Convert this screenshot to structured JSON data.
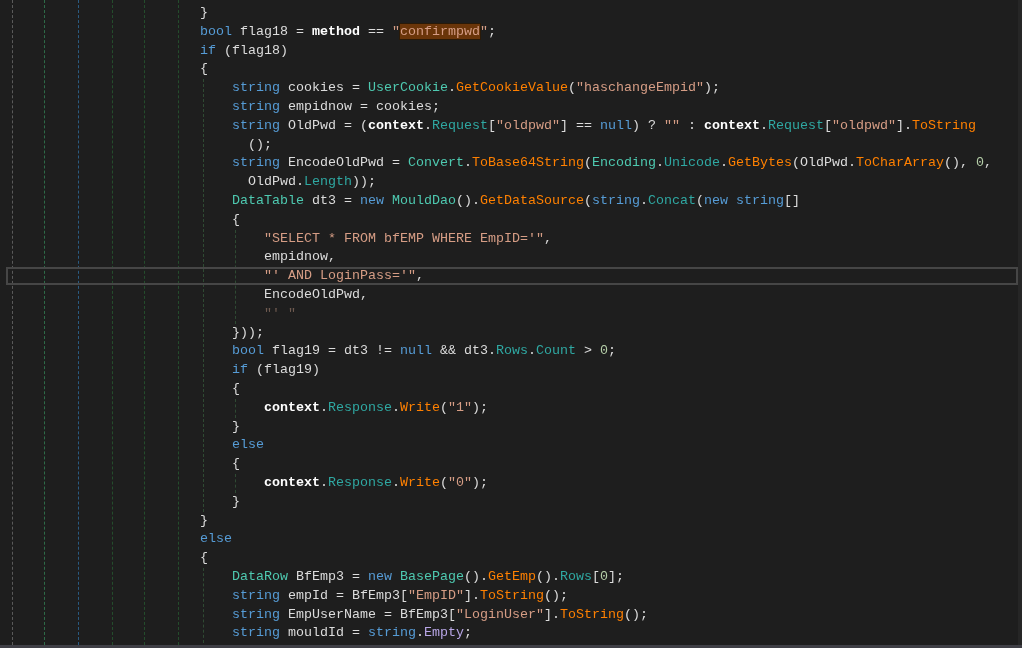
{
  "editor": {
    "lines": [
      {
        "kind": "line",
        "tokens": [
          {
            "text": "}",
            "kind": "plain"
          }
        ]
      },
      {
        "kind": "line",
        "tokens": [
          {
            "text": "bool",
            "kind": "kw"
          },
          {
            "text": " flag18 = ",
            "kind": "plain"
          },
          {
            "text": "method",
            "kind": "bold"
          },
          {
            "text": " == ",
            "kind": "plain"
          },
          {
            "text": "\"",
            "kind": "str"
          },
          {
            "text": "confirmpwd",
            "kind": "match"
          },
          {
            "text": "\"",
            "kind": "str"
          },
          {
            "text": ";",
            "kind": "plain"
          }
        ]
      },
      {
        "kind": "line",
        "tokens": [
          {
            "text": "if",
            "kind": "kw"
          },
          {
            "text": " (flag18)",
            "kind": "plain"
          }
        ]
      },
      {
        "kind": "line",
        "tokens": [
          {
            "text": "{",
            "kind": "plain"
          }
        ]
      },
      {
        "kind": "block",
        "children": [
          {
            "kind": "line",
            "tokens": [
              {
                "text": "string",
                "kind": "kw"
              },
              {
                "text": " cookies = ",
                "kind": "plain"
              },
              {
                "text": "UserCookie",
                "kind": "type"
              },
              {
                "text": ".",
                "kind": "plain"
              },
              {
                "text": "GetCookieValue",
                "kind": "method"
              },
              {
                "text": "(",
                "kind": "plain"
              },
              {
                "text": "\"haschangeEmpid\"",
                "kind": "str"
              },
              {
                "text": ");",
                "kind": "plain"
              }
            ]
          },
          {
            "kind": "line",
            "tokens": [
              {
                "text": "string",
                "kind": "kw"
              },
              {
                "text": " empidnow = cookies;",
                "kind": "plain"
              }
            ]
          },
          {
            "kind": "line",
            "tokens": [
              {
                "text": "string",
                "kind": "kw"
              },
              {
                "text": " OldPwd = (",
                "kind": "plain"
              },
              {
                "text": "context",
                "kind": "bold"
              },
              {
                "text": ".",
                "kind": "plain"
              },
              {
                "text": "Request",
                "kind": "member"
              },
              {
                "text": "[",
                "kind": "plain"
              },
              {
                "text": "\"oldpwd\"",
                "kind": "str"
              },
              {
                "text": "] == ",
                "kind": "plain"
              },
              {
                "text": "null",
                "kind": "kw"
              },
              {
                "text": ") ? ",
                "kind": "plain"
              },
              {
                "text": "\"\"",
                "kind": "str"
              },
              {
                "text": " : ",
                "kind": "plain"
              },
              {
                "text": "context",
                "kind": "bold"
              },
              {
                "text": ".",
                "kind": "plain"
              },
              {
                "text": "Request",
                "kind": "member"
              },
              {
                "text": "[",
                "kind": "plain"
              },
              {
                "text": "\"oldpwd\"",
                "kind": "str"
              },
              {
                "text": "].",
                "kind": "plain"
              },
              {
                "text": "ToString",
                "kind": "method"
              }
            ]
          },
          {
            "kind": "wrap",
            "tokens": [
              {
                "text": "();",
                "kind": "plain"
              }
            ]
          },
          {
            "kind": "line",
            "tokens": [
              {
                "text": "string",
                "kind": "kw"
              },
              {
                "text": " EncodeOldPwd = ",
                "kind": "plain"
              },
              {
                "text": "Convert",
                "kind": "type"
              },
              {
                "text": ".",
                "kind": "plain"
              },
              {
                "text": "ToBase64String",
                "kind": "method"
              },
              {
                "text": "(",
                "kind": "plain"
              },
              {
                "text": "Encoding",
                "kind": "type"
              },
              {
                "text": ".",
                "kind": "plain"
              },
              {
                "text": "Unicode",
                "kind": "member"
              },
              {
                "text": ".",
                "kind": "plain"
              },
              {
                "text": "GetBytes",
                "kind": "method"
              },
              {
                "text": "(OldPwd.",
                "kind": "plain"
              },
              {
                "text": "ToCharArray",
                "kind": "method"
              },
              {
                "text": "(), ",
                "kind": "plain"
              },
              {
                "text": "0",
                "kind": "num"
              },
              {
                "text": ",",
                "kind": "plain"
              }
            ]
          },
          {
            "kind": "wrap",
            "tokens": [
              {
                "text": "OldPwd.",
                "kind": "plain"
              },
              {
                "text": "Length",
                "kind": "member"
              },
              {
                "text": "));",
                "kind": "plain"
              }
            ]
          },
          {
            "kind": "line",
            "tokens": [
              {
                "text": "DataTable",
                "kind": "type"
              },
              {
                "text": " dt3 = ",
                "kind": "plain"
              },
              {
                "text": "new",
                "kind": "kw"
              },
              {
                "text": " MouldDao",
                "kind": "type"
              },
              {
                "text": "().",
                "kind": "plain"
              },
              {
                "text": "GetDataSource",
                "kind": "method"
              },
              {
                "text": "(",
                "kind": "plain"
              },
              {
                "text": "string",
                "kind": "kw"
              },
              {
                "text": ".",
                "kind": "plain"
              },
              {
                "text": "Concat",
                "kind": "member"
              },
              {
                "text": "(",
                "kind": "plain"
              },
              {
                "text": "new",
                "kind": "kw"
              },
              {
                "text": " string",
                "kind": "kw"
              },
              {
                "text": "[]",
                "kind": "plain"
              }
            ]
          },
          {
            "kind": "line",
            "tokens": [
              {
                "text": "{",
                "kind": "plain"
              }
            ]
          },
          {
            "kind": "block",
            "children": [
              {
                "kind": "line",
                "tokens": [
                  {
                    "text": "\"SELECT * FROM bfEMP WHERE EmpID='\"",
                    "kind": "str"
                  },
                  {
                    "text": ",",
                    "kind": "plain"
                  }
                ]
              },
              {
                "kind": "line",
                "tokens": [
                  {
                    "text": "empidnow,",
                    "kind": "plain"
                  }
                ]
              },
              {
                "kind": "current",
                "tokens": [
                  {
                    "text": "\"' AND LoginPass='\"",
                    "kind": "str"
                  },
                  {
                    "text": ",",
                    "kind": "plain"
                  }
                ]
              },
              {
                "kind": "line",
                "tokens": [
                  {
                    "text": "EncodeOldPwd,",
                    "kind": "plain"
                  }
                ]
              },
              {
                "kind": "line",
                "tokens": [
                  {
                    "text": "\"' \"",
                    "kind": "dim"
                  }
                ]
              }
            ]
          },
          {
            "kind": "line",
            "tokens": [
              {
                "text": "}));",
                "kind": "plain"
              }
            ]
          },
          {
            "kind": "line",
            "tokens": [
              {
                "text": "bool",
                "kind": "kw"
              },
              {
                "text": " flag19 = dt3 != ",
                "kind": "plain"
              },
              {
                "text": "null",
                "kind": "kw"
              },
              {
                "text": " && dt3.",
                "kind": "plain"
              },
              {
                "text": "Rows",
                "kind": "member"
              },
              {
                "text": ".",
                "kind": "plain"
              },
              {
                "text": "Count",
                "kind": "member"
              },
              {
                "text": " > ",
                "kind": "plain"
              },
              {
                "text": "0",
                "kind": "num"
              },
              {
                "text": ";",
                "kind": "plain"
              }
            ]
          },
          {
            "kind": "line",
            "tokens": [
              {
                "text": "if",
                "kind": "kw"
              },
              {
                "text": " (flag19)",
                "kind": "plain"
              }
            ]
          },
          {
            "kind": "line",
            "tokens": [
              {
                "text": "{",
                "kind": "plain"
              }
            ]
          },
          {
            "kind": "block",
            "children": [
              {
                "kind": "line",
                "tokens": [
                  {
                    "text": "context",
                    "kind": "bold"
                  },
                  {
                    "text": ".",
                    "kind": "plain"
                  },
                  {
                    "text": "Response",
                    "kind": "member"
                  },
                  {
                    "text": ".",
                    "kind": "plain"
                  },
                  {
                    "text": "Write",
                    "kind": "method"
                  },
                  {
                    "text": "(",
                    "kind": "plain"
                  },
                  {
                    "text": "\"1\"",
                    "kind": "str"
                  },
                  {
                    "text": ");",
                    "kind": "plain"
                  }
                ]
              }
            ]
          },
          {
            "kind": "line",
            "tokens": [
              {
                "text": "}",
                "kind": "plain"
              }
            ]
          },
          {
            "kind": "line",
            "tokens": [
              {
                "text": "else",
                "kind": "kw"
              }
            ]
          },
          {
            "kind": "line",
            "tokens": [
              {
                "text": "{",
                "kind": "plain"
              }
            ]
          },
          {
            "kind": "block",
            "children": [
              {
                "kind": "line",
                "tokens": [
                  {
                    "text": "context",
                    "kind": "bold"
                  },
                  {
                    "text": ".",
                    "kind": "plain"
                  },
                  {
                    "text": "Response",
                    "kind": "member"
                  },
                  {
                    "text": ".",
                    "kind": "plain"
                  },
                  {
                    "text": "Write",
                    "kind": "method"
                  },
                  {
                    "text": "(",
                    "kind": "plain"
                  },
                  {
                    "text": "\"0\"",
                    "kind": "str"
                  },
                  {
                    "text": ");",
                    "kind": "plain"
                  }
                ]
              }
            ]
          },
          {
            "kind": "line",
            "tokens": [
              {
                "text": "}",
                "kind": "plain"
              }
            ]
          }
        ]
      },
      {
        "kind": "line",
        "tokens": [
          {
            "text": "}",
            "kind": "plain"
          }
        ]
      },
      {
        "kind": "line",
        "tokens": [
          {
            "text": "else",
            "kind": "kw"
          }
        ]
      },
      {
        "kind": "line",
        "tokens": [
          {
            "text": "{",
            "kind": "plain"
          }
        ]
      },
      {
        "kind": "block",
        "children": [
          {
            "kind": "line",
            "tokens": [
              {
                "text": "DataRow",
                "kind": "type"
              },
              {
                "text": " BfEmp3 = ",
                "kind": "plain"
              },
              {
                "text": "new",
                "kind": "kw"
              },
              {
                "text": " BasePage",
                "kind": "type"
              },
              {
                "text": "().",
                "kind": "plain"
              },
              {
                "text": "GetEmp",
                "kind": "method"
              },
              {
                "text": "().",
                "kind": "plain"
              },
              {
                "text": "Rows",
                "kind": "member"
              },
              {
                "text": "[",
                "kind": "plain"
              },
              {
                "text": "0",
                "kind": "num"
              },
              {
                "text": "];",
                "kind": "plain"
              }
            ]
          },
          {
            "kind": "line",
            "tokens": [
              {
                "text": "string",
                "kind": "kw"
              },
              {
                "text": " empId = BfEmp3[",
                "kind": "plain"
              },
              {
                "text": "\"EmpID\"",
                "kind": "str"
              },
              {
                "text": "].",
                "kind": "plain"
              },
              {
                "text": "ToString",
                "kind": "method"
              },
              {
                "text": "();",
                "kind": "plain"
              }
            ]
          },
          {
            "kind": "line",
            "tokens": [
              {
                "text": "string",
                "kind": "kw"
              },
              {
                "text": " EmpUserName = BfEmp3[",
                "kind": "plain"
              },
              {
                "text": "\"LoginUser\"",
                "kind": "str"
              },
              {
                "text": "].",
                "kind": "plain"
              },
              {
                "text": "ToString",
                "kind": "method"
              },
              {
                "text": "();",
                "kind": "plain"
              }
            ]
          },
          {
            "kind": "line",
            "tokens": [
              {
                "text": "string",
                "kind": "kw"
              },
              {
                "text": " mouldId = ",
                "kind": "plain"
              },
              {
                "text": "string",
                "kind": "kw"
              },
              {
                "text": ".",
                "kind": "plain"
              },
              {
                "text": "Empty",
                "kind": "enum"
              },
              {
                "text": ";",
                "kind": "plain"
              }
            ]
          }
        ]
      }
    ]
  }
}
